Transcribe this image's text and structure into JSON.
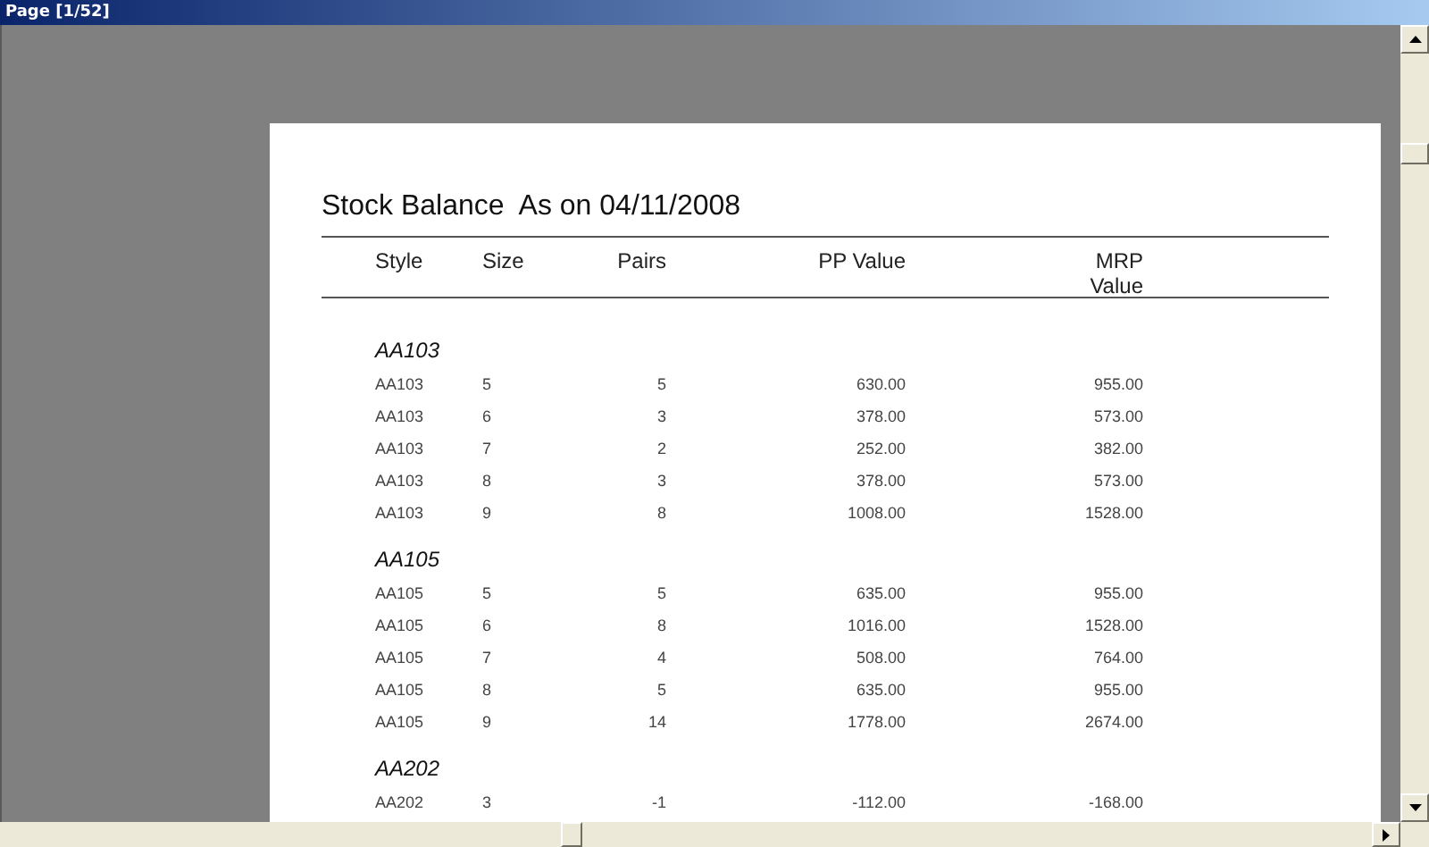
{
  "window": {
    "title": "Page [1/52]"
  },
  "report": {
    "title": "Stock Balance  As on 04/11/2008",
    "columns": [
      "Style",
      "Size",
      "Pairs",
      "PP Value",
      "MRP Value"
    ],
    "groups": [
      {
        "name": "AA103",
        "rows": [
          [
            "AA103",
            "5",
            "5",
            "630.00",
            "955.00"
          ],
          [
            "AA103",
            "6",
            "3",
            "378.00",
            "573.00"
          ],
          [
            "AA103",
            "7",
            "2",
            "252.00",
            "382.00"
          ],
          [
            "AA103",
            "8",
            "3",
            "378.00",
            "573.00"
          ],
          [
            "AA103",
            "9",
            "8",
            "1008.00",
            "1528.00"
          ]
        ]
      },
      {
        "name": "AA105",
        "rows": [
          [
            "AA105",
            "5",
            "5",
            "635.00",
            "955.00"
          ],
          [
            "AA105",
            "6",
            "8",
            "1016.00",
            "1528.00"
          ],
          [
            "AA105",
            "7",
            "4",
            "508.00",
            "764.00"
          ],
          [
            "AA105",
            "8",
            "5",
            "635.00",
            "955.00"
          ],
          [
            "AA105",
            "9",
            "14",
            "1778.00",
            "2674.00"
          ]
        ]
      },
      {
        "name": "AA202",
        "rows": [
          [
            "AA202",
            "3",
            "-1",
            "-112.00",
            "-168.00"
          ]
        ]
      }
    ]
  }
}
